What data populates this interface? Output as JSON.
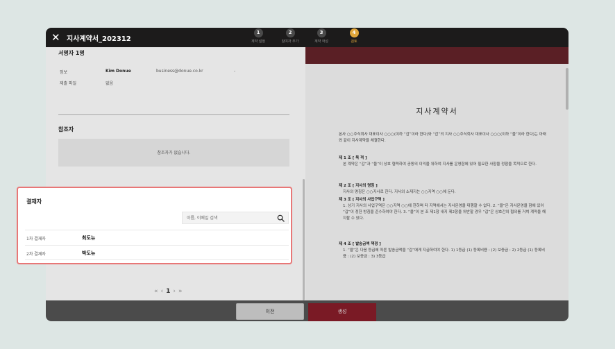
{
  "window": {
    "title": "지사계약서_202312",
    "steps": [
      {
        "num": "1",
        "label": "계약 설정"
      },
      {
        "num": "2",
        "label": "참여자 추가"
      },
      {
        "num": "3",
        "label": "계약 작성"
      },
      {
        "num": "4",
        "label": "검토"
      }
    ]
  },
  "left": {
    "signer_title": "서명자 1명",
    "info_label": "정보",
    "signer_name": "Kim Donue",
    "signer_email": "business@donue.co.kr",
    "signer_dash": "-",
    "attach_label": "제출 파일",
    "attach_value": "없음",
    "reference_title": "참조자",
    "reference_empty": "참조자가 없습니다.",
    "page": "1"
  },
  "contract": {
    "title": "지사계약서",
    "intro": "본사 ○○주식회사 대표이사 ○○○(이하 “갑”이라 한다)와 “갑”의 지사 ○○주식회사 대표이사 ○○○(이하 “을”이라 한다)는 아래와 같이 지사계약을 체결한다.",
    "art1_title": "제 1 조 [ 목 적 ]",
    "art1_body": "본 계약은 “갑”과 “을”이 상호 협력하여 공동의 이익을 위하여 지사를 운영함에 있어 필요한 사항을 정함을 목적으로 한다.",
    "art2_title": "제 2 조 [ 지사의 명칭 ]",
    "art2_body": "지사의 명칭은 ○○지사로 한다. 지사의 소재지는 ○○지역 ○○에 둔다.",
    "art3_title": "제 3 조 [ 지사의 사업구역 ]",
    "art3_body": "1. 상기 지사의 사업구역은 ○○지역 ○○에 한하며 타 지역에서는 지사운영을 대행할 수 없다. 2. “을”은 지사운영을 함에 있어 “갑”이 정한 방침을 준수하여야 한다. 3. “을”이 본 조 제1항 내지 제2항을 위반할 경우 “갑”은 상호간의 협의를 거쳐 계약을 해지할 수 있다.",
    "art4_title": "제 4 조 [ 발송금액 책정 ]",
    "art4_body": "1. “을”은 다음 등급에 따른 발송금액을 “갑”에게 지급하여야 한다. 1) 1등급 (1) 등록비용 : (2) 보증금 : 2) 2등급 (1) 등록비용 : (2) 보증금 : 3) 3등급"
  },
  "footer": {
    "prev_label": "이전",
    "create_label": "생성"
  },
  "modal": {
    "title": "결재자",
    "search_placeholder": "이름, 이메일 검색",
    "approvers": [
      {
        "order": "1차 결재자",
        "name": "최도뉴"
      },
      {
        "order": "2차 결재자",
        "name": "박도뉴"
      }
    ]
  }
}
